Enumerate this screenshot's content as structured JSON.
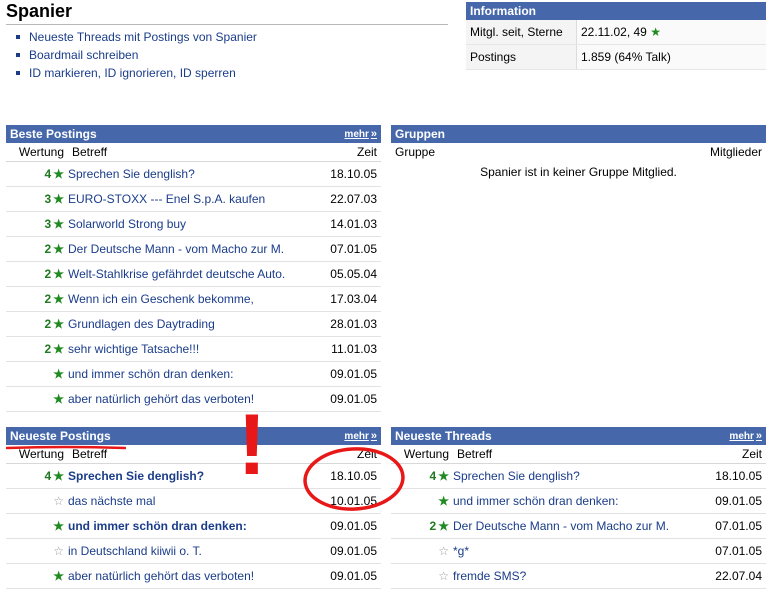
{
  "user": {
    "name": "Spanier",
    "actions": [
      "Neueste Threads mit Postings von Spanier",
      "Boardmail schreiben",
      "ID markieren, ID ignorieren, ID sperren"
    ]
  },
  "info": {
    "title": "Information",
    "rows": [
      {
        "label": "Mitgl. seit, Sterne",
        "value": "22.11.02, 49"
      },
      {
        "label": "Postings",
        "value": "1.859 (64% Talk)"
      }
    ]
  },
  "labels": {
    "mehr": "mehr",
    "wertung": "Wertung",
    "betreff": "Betreff",
    "zeit": "Zeit",
    "gruppe": "Gruppe",
    "mitglieder": "Mitglieder",
    "star": "★",
    "star_empty": "☆",
    "arrow": "»"
  },
  "beste": {
    "title": "Beste Postings",
    "rows": [
      {
        "score": "4",
        "subject": "Sprechen Sie denglish?",
        "time": "18.10.05"
      },
      {
        "score": "3",
        "subject": "EURO-STOXX --- Enel S.p.A. kaufen",
        "time": "22.07.03"
      },
      {
        "score": "3",
        "subject": "Solarworld Strong buy",
        "time": "14.01.03"
      },
      {
        "score": "2",
        "subject": "Der Deutsche Mann - vom Macho zur M.",
        "time": "07.01.05"
      },
      {
        "score": "2",
        "subject": "Welt-Stahlkrise gefährdet deutsche Auto.",
        "time": "05.05.04"
      },
      {
        "score": "2",
        "subject": "Wenn ich ein Geschenk bekomme,",
        "time": "17.03.04"
      },
      {
        "score": "2",
        "subject": "Grundlagen des Daytrading",
        "time": "28.01.03"
      },
      {
        "score": "2",
        "subject": "sehr wichtige Tatsache!!!",
        "time": "11.01.03"
      },
      {
        "score": "",
        "subject": "und immer schön dran denken:",
        "time": "09.01.05"
      },
      {
        "score": "",
        "subject": "aber natürlich gehört das verboten!",
        "time": "09.01.05"
      }
    ]
  },
  "gruppen": {
    "title": "Gruppen",
    "empty": "Spanier ist in keiner Gruppe Mitglied."
  },
  "neueste_postings": {
    "title": "Neueste Postings",
    "rows": [
      {
        "score": "4",
        "star": "filled",
        "subject": "Sprechen Sie denglish?",
        "bold": true,
        "time": "18.10.05"
      },
      {
        "score": "",
        "star": "empty",
        "subject": "das nächste mal",
        "bold": false,
        "time": "10.01.05"
      },
      {
        "score": "",
        "star": "filled",
        "subject": "und immer schön dran denken:",
        "bold": true,
        "time": "09.01.05"
      },
      {
        "score": "",
        "star": "empty",
        "subject": "in Deutschland kiiwii o. T.",
        "bold": false,
        "time": "09.01.05"
      },
      {
        "score": "",
        "star": "filled",
        "subject": "aber natürlich gehört das verboten!",
        "bold": false,
        "time": "09.01.05"
      }
    ]
  },
  "neueste_threads": {
    "title": "Neueste Threads",
    "rows": [
      {
        "score": "4",
        "star": "filled",
        "subject": "Sprechen Sie denglish?",
        "time": "18.10.05"
      },
      {
        "score": "",
        "star": "filled",
        "subject": "und immer schön dran denken:",
        "time": "09.01.05"
      },
      {
        "score": "2",
        "star": "filled",
        "subject": "Der Deutsche Mann - vom Macho zur M.",
        "time": "07.01.05"
      },
      {
        "score": "",
        "star": "empty",
        "subject": "*g*",
        "time": "07.01.05"
      },
      {
        "score": "",
        "star": "empty",
        "subject": "fremde SMS?",
        "time": "22.07.04"
      }
    ]
  },
  "annotation": {
    "exclamation": "!",
    "color": "#e81818"
  },
  "colors": {
    "header_bg": "#4668ab",
    "link": "#1a3c8a",
    "star": "#1f8a1f"
  }
}
